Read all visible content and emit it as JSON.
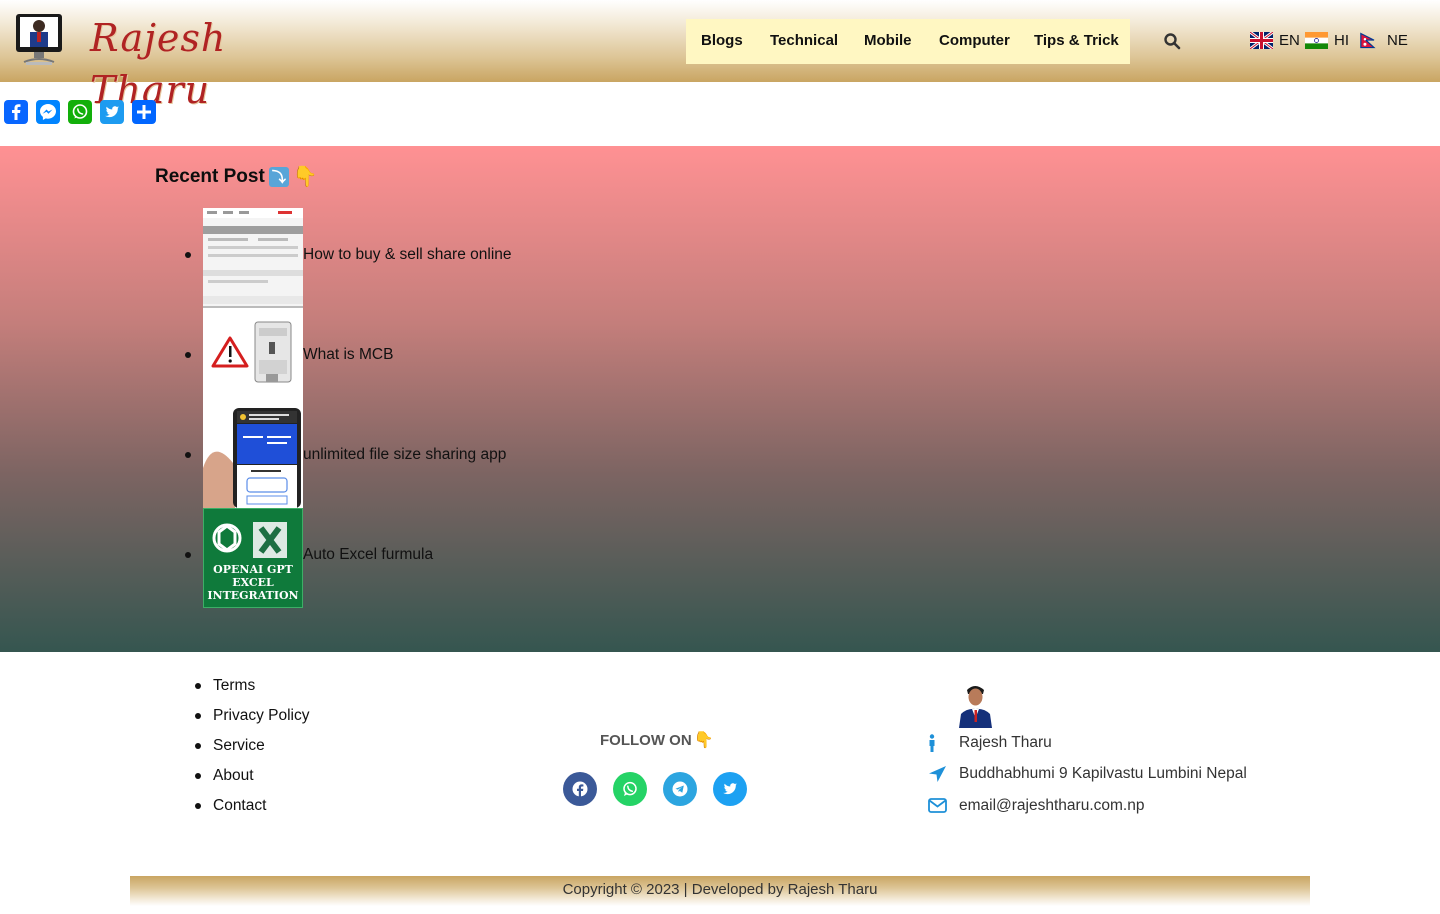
{
  "header": {
    "logo_text": "Rajesh Tharu",
    "nav": [
      {
        "label": "Blogs"
      },
      {
        "label": "Technical"
      },
      {
        "label": "Mobile"
      },
      {
        "label": "Computer"
      },
      {
        "label": "Tips & Trick"
      }
    ],
    "search_icon": "search-icon",
    "languages": [
      {
        "code": "EN",
        "flag": "uk-flag"
      },
      {
        "code": "HI",
        "flag": "india-flag"
      },
      {
        "code": "NE",
        "flag": "nepal-flag"
      }
    ]
  },
  "share_bar": {
    "items": [
      "facebook-icon",
      "messenger-icon",
      "whatsapp-icon",
      "twitter-icon",
      "share-icon"
    ]
  },
  "recent": {
    "title": "Recent Post",
    "title_emoji": "⤵️👇",
    "posts": [
      {
        "title": "How to buy & sell share online"
      },
      {
        "title": "What is MCB"
      },
      {
        "title": "unlimited file size sharing app"
      },
      {
        "title": "Auto Excel furmula",
        "thumb_text": [
          "OPENAI GPT",
          "EXCEL",
          "INTEGRATION"
        ]
      }
    ]
  },
  "footer": {
    "links": [
      "Terms",
      "Privacy Policy",
      "Service",
      "About",
      "Contact"
    ],
    "follow_title": "FOLLOW ON",
    "follow_emoji": "👇",
    "social": [
      {
        "name": "facebook",
        "color": "#3b5998"
      },
      {
        "name": "whatsapp",
        "color": "#25d366"
      },
      {
        "name": "telegram",
        "color": "#2ca5e0"
      },
      {
        "name": "twitter",
        "color": "#1da1f2"
      }
    ],
    "contact": {
      "name": "Rajesh Tharu",
      "address": "Buddhabhumi 9 Kapilvastu Lumbini Nepal",
      "email": "email@rajeshtharu.com.np"
    },
    "copyright": "Copyright © 2023 | Developed by Rajesh Tharu"
  },
  "colors": {
    "accent_blue": "#1e90d8",
    "header_gold": "#c9a562",
    "nav_bg": "#fff7c2"
  }
}
